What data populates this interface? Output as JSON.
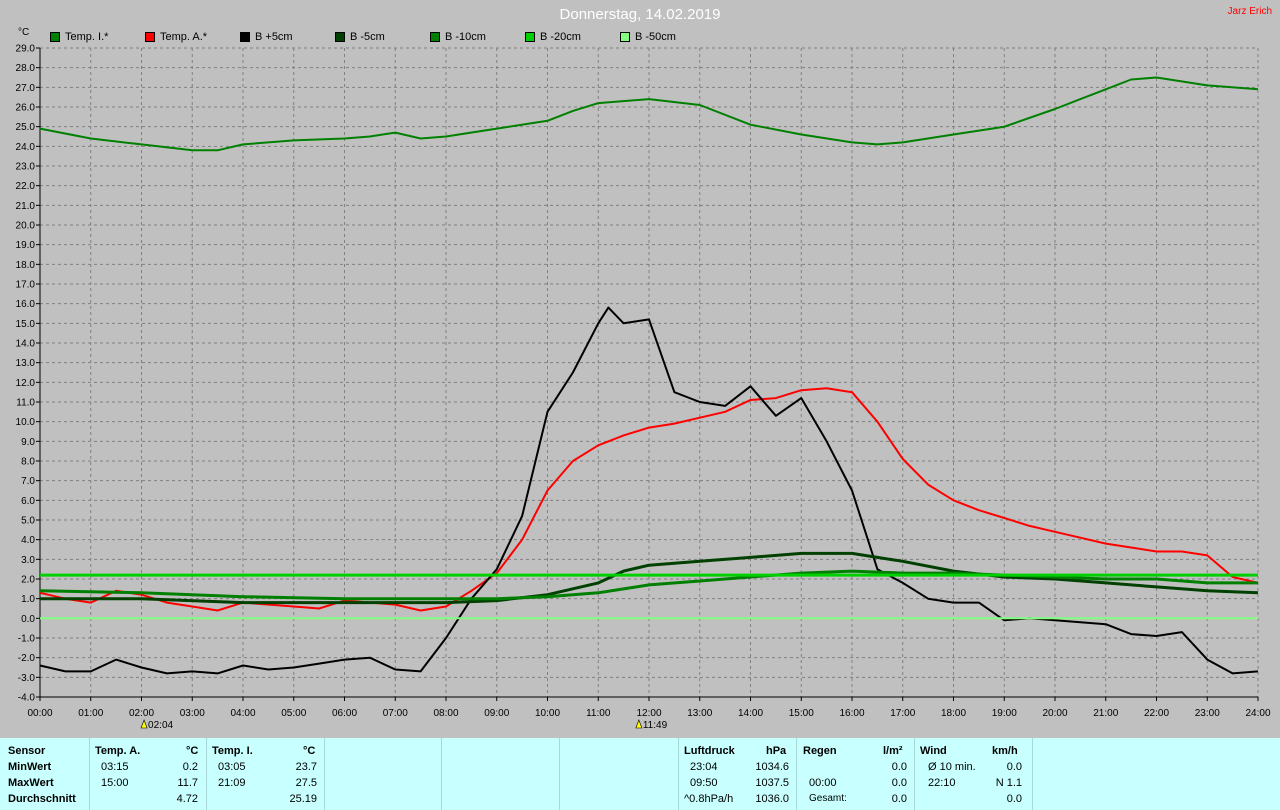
{
  "header": {
    "title": "Donnerstag, 14.02.2019",
    "author": "Jarz Erich",
    "unit": "°C"
  },
  "legend": [
    {
      "label": "Temp. I.*",
      "color": "#008000"
    },
    {
      "label": "Temp. A.*",
      "color": "#ff0000"
    },
    {
      "label": "B +5cm",
      "color": "#000000"
    },
    {
      "label": "B -5cm",
      "color": "#004000"
    },
    {
      "label": "B -10cm",
      "color": "#008000"
    },
    {
      "label": "B -20cm",
      "color": "#00d000"
    },
    {
      "label": "B -50cm",
      "color": "#80ff80"
    }
  ],
  "chart_data": {
    "type": "line",
    "xlim": [
      0,
      24
    ],
    "ylim": [
      -4,
      29
    ],
    "grid": true,
    "x_ticks": [
      "00:00",
      "01:00",
      "02:00",
      "03:00",
      "04:00",
      "05:00",
      "06:00",
      "07:00",
      "08:00",
      "09:00",
      "10:00",
      "11:00",
      "12:00",
      "13:00",
      "14:00",
      "15:00",
      "16:00",
      "17:00",
      "18:00",
      "19:00",
      "20:00",
      "21:00",
      "22:00",
      "23:00",
      "24:00"
    ],
    "y_ticks": [
      "-4.0",
      "-3.0",
      "-2.0",
      "-1.0",
      "0.0",
      "1.0",
      "2.0",
      "3.0",
      "4.0",
      "5.0",
      "6.0",
      "7.0",
      "8.0",
      "9.0",
      "10.0",
      "11.0",
      "12.0",
      "13.0",
      "14.0",
      "15.0",
      "16.0",
      "17.0",
      "18.0",
      "19.0",
      "20.0",
      "21.0",
      "22.0",
      "23.0",
      "24.0",
      "25.0",
      "26.0",
      "27.0",
      "28.0",
      "29.0"
    ],
    "annotations": [
      {
        "x": 2.07,
        "label": "02:04"
      },
      {
        "x": 11.82,
        "label": "11:49"
      }
    ],
    "series": [
      {
        "name": "Temp. I.*",
        "color": "#008000",
        "width": 2,
        "x": [
          0,
          1,
          2,
          3,
          3.5,
          4,
          5,
          6,
          6.5,
          7,
          7.5,
          8,
          9,
          10,
          10.5,
          11,
          12,
          13,
          14,
          15,
          16,
          16.5,
          17,
          18,
          19,
          20,
          20.5,
          21,
          21.5,
          22,
          23,
          24
        ],
        "y": [
          24.9,
          24.4,
          24.1,
          23.8,
          23.8,
          24.1,
          24.3,
          24.4,
          24.5,
          24.7,
          24.4,
          24.5,
          24.9,
          25.3,
          25.8,
          26.2,
          26.4,
          26.1,
          25.1,
          24.6,
          24.2,
          24.1,
          24.2,
          24.6,
          25.0,
          25.9,
          26.4,
          26.9,
          27.4,
          27.5,
          27.1,
          26.9
        ]
      },
      {
        "name": "Temp. A.*",
        "color": "#ff0000",
        "width": 2,
        "x": [
          0,
          0.5,
          1,
          1.5,
          2,
          2.5,
          3,
          3.5,
          4,
          5,
          5.5,
          6,
          7,
          7.5,
          8,
          8.5,
          9,
          9.5,
          10,
          10.5,
          11,
          11.5,
          12,
          12.5,
          13,
          13.5,
          14,
          14.5,
          15,
          15.5,
          16,
          16.5,
          17,
          17.5,
          18,
          18.5,
          19,
          19.5,
          20,
          20.5,
          21,
          21.5,
          22,
          22.5,
          23,
          23.5,
          24
        ],
        "y": [
          1.3,
          1.0,
          0.8,
          1.4,
          1.2,
          0.8,
          0.6,
          0.4,
          0.8,
          0.6,
          0.5,
          0.9,
          0.7,
          0.4,
          0.6,
          1.4,
          2.3,
          4.0,
          6.5,
          8.0,
          8.8,
          9.3,
          9.7,
          9.9,
          10.2,
          10.5,
          11.1,
          11.2,
          11.6,
          11.7,
          11.5,
          10.0,
          8.1,
          6.8,
          6.0,
          5.5,
          5.1,
          4.7,
          4.4,
          4.1,
          3.8,
          3.6,
          3.4,
          3.4,
          3.2,
          2.1,
          1.8
        ]
      },
      {
        "name": "B +5cm",
        "color": "#000000",
        "width": 2,
        "x": [
          0,
          0.5,
          1,
          1.5,
          2,
          2.5,
          3,
          3.5,
          4,
          4.5,
          5,
          5.5,
          6,
          6.5,
          7,
          7.5,
          8,
          8.5,
          9,
          9.5,
          10,
          10.5,
          11,
          11.2,
          11.5,
          12,
          12.5,
          13,
          13.5,
          14,
          14.5,
          15,
          15.5,
          16,
          16.5,
          17,
          17.5,
          18,
          18.5,
          19,
          19.5,
          20,
          20.5,
          21,
          21.5,
          22,
          22.5,
          23,
          23.5,
          24
        ],
        "y": [
          -2.4,
          -2.7,
          -2.7,
          -2.1,
          -2.5,
          -2.8,
          -2.7,
          -2.8,
          -2.4,
          -2.6,
          -2.5,
          -2.3,
          -2.1,
          -2.0,
          -2.6,
          -2.7,
          -1.0,
          1.0,
          2.5,
          5.2,
          10.5,
          12.5,
          15.0,
          15.8,
          15.0,
          15.2,
          11.5,
          11.0,
          10.8,
          11.8,
          10.3,
          11.2,
          9.0,
          6.5,
          2.5,
          1.8,
          1.0,
          0.8,
          0.8,
          -0.1,
          0.0,
          -0.1,
          -0.2,
          -0.3,
          -0.8,
          -0.9,
          -0.7,
          -2.1,
          -2.8,
          -2.7
        ]
      },
      {
        "name": "B -5cm",
        "color": "#004000",
        "width": 3,
        "x": [
          0,
          2,
          4,
          6,
          8,
          9,
          10,
          11,
          11.5,
          12,
          13,
          14,
          15,
          16,
          16.5,
          17,
          18,
          19,
          20,
          21,
          22,
          23,
          24
        ],
        "y": [
          1.0,
          1.0,
          0.8,
          0.8,
          0.8,
          0.9,
          1.2,
          1.8,
          2.4,
          2.7,
          2.9,
          3.1,
          3.3,
          3.3,
          3.1,
          2.9,
          2.4,
          2.1,
          2.0,
          1.8,
          1.6,
          1.4,
          1.3
        ]
      },
      {
        "name": "B -10cm",
        "color": "#008000",
        "width": 3,
        "x": [
          0,
          2,
          4,
          6,
          7,
          8,
          9,
          10,
          11,
          12,
          13,
          14,
          15,
          16,
          17,
          18,
          19,
          20,
          21,
          22,
          23,
          24
        ],
        "y": [
          1.4,
          1.3,
          1.1,
          1.0,
          1.0,
          1.0,
          1.0,
          1.1,
          1.3,
          1.7,
          1.9,
          2.1,
          2.3,
          2.4,
          2.3,
          2.3,
          2.2,
          2.1,
          2.0,
          2.0,
          1.8,
          1.8
        ]
      },
      {
        "name": "B -20cm",
        "color": "#00d000",
        "width": 3,
        "x": [
          0,
          8,
          10,
          14,
          16,
          18,
          20,
          24
        ],
        "y": [
          2.2,
          2.2,
          2.2,
          2.2,
          2.2,
          2.2,
          2.2,
          2.2
        ]
      },
      {
        "name": "B -50cm",
        "color": "#80ff80",
        "width": 2,
        "x": [
          0,
          24
        ],
        "y": [
          0.0,
          0.0
        ]
      }
    ]
  },
  "panel": {
    "sensor": {
      "header": "Sensor",
      "rows": [
        "MinWert",
        "MaxWert",
        "Durchschnitt"
      ]
    },
    "temp_a": {
      "header": "Temp. A.",
      "unit": "°C",
      "min_time": "03:15",
      "min_value": "0.2",
      "max_time": "15:00",
      "max_value": "11.7",
      "avg_value": "4.72"
    },
    "temp_i": {
      "header": "Temp. I.",
      "unit": "°C",
      "min_time": "03:05",
      "min_value": "23.7",
      "max_time": "21:09",
      "max_value": "27.5",
      "avg_value": "25.19"
    },
    "pressure": {
      "header": "Luftdruck",
      "unit": "hPa",
      "min_time": "23:04",
      "min_value": "1034.6",
      "max_time": "09:50",
      "max_value": "1037.5",
      "trend_label": "^0.8hPa/h",
      "current_value": "1036.0"
    },
    "rain": {
      "header": "Regen",
      "unit": "l/m²",
      "r1_value": "0.0",
      "r2_time": "00:00",
      "r2_value": "0.0",
      "total_label": "Gesamt:",
      "total_value": "0.0"
    },
    "wind": {
      "header": "Wind",
      "unit": "km/h",
      "avg_label": "Ø 10 min.",
      "avg_value": "0.0",
      "max_time": "22:10",
      "max_value": "N 1.1",
      "r3_value": "0.0"
    }
  }
}
